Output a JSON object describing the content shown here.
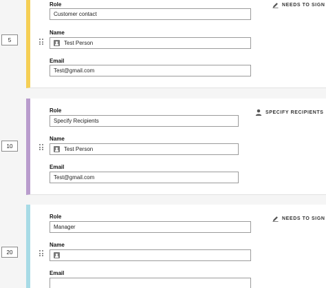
{
  "recipients": [
    {
      "order": "5",
      "accent": "#f5cf55",
      "role_label": "Role",
      "role_value": "Customer contact",
      "name_label": "Name",
      "name_value": "Test Person",
      "email_label": "Email",
      "email_value": "Test@gmail.com",
      "action_label": "NEEDS TO SIGN",
      "action_icon": "pen-icon"
    },
    {
      "order": "10",
      "accent": "#b99ccd",
      "role_label": "Role",
      "role_value": "Specify Recipients",
      "name_label": "Name",
      "name_value": "Test Person",
      "email_label": "Email",
      "email_value": "Test@gmail.com",
      "action_label": "SPECIFY RECIPIENTS",
      "action_icon": "person-icon"
    },
    {
      "order": "20",
      "accent": "#a8dbe6",
      "role_label": "Role",
      "role_value": "Manager",
      "name_label": "Name",
      "name_value": "",
      "email_label": "Email",
      "email_value": "",
      "action_label": "NEEDS TO SIGN",
      "action_icon": "pen-icon"
    }
  ],
  "caret": "▼"
}
